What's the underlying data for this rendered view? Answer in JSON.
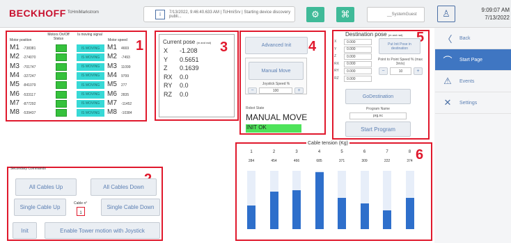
{
  "header": {
    "logo": "BECKHOFF",
    "target": "TcHmiMarkstrom",
    "message": "7/13/2022, 9:46:40.633 AM | TcHmiSrv | Starting device discovery publi...",
    "user": "__SystemGuest",
    "time": "9:09:07 AM",
    "date": "7/13/2022"
  },
  "motors": {
    "col_position": "Motor position",
    "col_onoff": "Motors On/Off Status",
    "col_moving": "Is moving signal",
    "col_speed": "Motor speed",
    "rows": [
      {
        "name": "M1",
        "pos": "-738381",
        "moving": "IS MOVING",
        "name2": "M1",
        "speed": "4669"
      },
      {
        "name": "M2",
        "pos": "-274070",
        "moving": "IS MOVING",
        "name2": "M2",
        "speed": "-7493"
      },
      {
        "name": "M3",
        "pos": "-701747",
        "moving": "IS MOVING",
        "name2": "M3",
        "speed": "11099"
      },
      {
        "name": "M4",
        "pos": "-327247",
        "moving": "IS MOVING",
        "name2": "M4",
        "speed": "9799"
      },
      {
        "name": "M5",
        "pos": "-841079",
        "moving": "IS MOVING",
        "name2": "M5",
        "speed": "277"
      },
      {
        "name": "M6",
        "pos": "-533117",
        "moving": "IS MOVING",
        "name2": "M6",
        "speed": "2835"
      },
      {
        "name": "M7",
        "pos": "-877292",
        "moving": "IS MOVING",
        "name2": "M7",
        "speed": "-11452"
      },
      {
        "name": "M8",
        "pos": "-539437",
        "moving": "IS MOVING",
        "name2": "M8",
        "speed": "-10384"
      }
    ]
  },
  "annotations": [
    "1",
    "2",
    "3",
    "4",
    "5",
    "6"
  ],
  "pose": {
    "title": "Current pose",
    "units": "(m and rad)",
    "rows": [
      {
        "label": "X",
        "value": "-1.208"
      },
      {
        "label": "Y",
        "value": "0.5651"
      },
      {
        "label": "Z",
        "value": "0.1639"
      },
      {
        "label": "RX",
        "value": "0.0"
      },
      {
        "label": "RY",
        "value": "0.0"
      },
      {
        "label": "RZ",
        "value": "0.0"
      }
    ]
  },
  "control": {
    "advanced_init": "Advanced Init",
    "manual_move": "Manual Move",
    "joystick_speed_label": "Joystick Speed %",
    "joystick_speed": "100",
    "minus": "−",
    "plus": "+",
    "robot_state_label": "Robot State",
    "robot_state": "MANUAL MOVE",
    "init_status": "INIT OK"
  },
  "destination": {
    "title": "Destination pose",
    "units": "(m and rad)",
    "fields": [
      {
        "label": "X",
        "value": "0.000"
      },
      {
        "label": "Y",
        "value": "0.000"
      },
      {
        "label": "Z",
        "value": "0.000"
      },
      {
        "label": "RX",
        "value": "0.000"
      },
      {
        "label": "RY",
        "value": "0.000"
      },
      {
        "label": "RZ",
        "value": "0.000"
      }
    ],
    "put_init_pose": "Put Init Pose in destination",
    "ptp_speed_label": "Point to Point Speed % (max 3m/s)",
    "ptp_speed": "10",
    "go_destination": "GoDestination",
    "program_name_label": "Program Name",
    "program_name": "prg.nc",
    "start_program": "Start Program"
  },
  "secondary": {
    "title": "Secondary Commands",
    "all_cables_up": "All Cables Up",
    "all_cables_down": "All Cables Down",
    "single_cable_up": "Single Cable Up",
    "single_cable_down": "Single Cable Down",
    "cable_n_label": "Cable n°",
    "cable_n": "1",
    "init": "Init",
    "enable_tower": "Enable Tower motion with Joystick"
  },
  "nav": {
    "back": "Back",
    "start_page": "Start Page",
    "events": "Events",
    "settings": "Settings"
  },
  "colors": {
    "brand_red": "#c8102e",
    "annotation_red": "#e0182c",
    "status_green": "#35c13c",
    "moving_cyan": "#37d9d6",
    "accent_blue": "#3f76c2",
    "header_green": "#3fba98"
  },
  "chart_data": {
    "type": "bar",
    "title": "Cable tension (Kg)",
    "categories": [
      "1",
      "2",
      "3",
      "4",
      "5",
      "6",
      "7",
      "8"
    ],
    "values": [
      284,
      454,
      466,
      685,
      371,
      309,
      222,
      374
    ],
    "ylim": [
      0,
      1400
    ]
  }
}
